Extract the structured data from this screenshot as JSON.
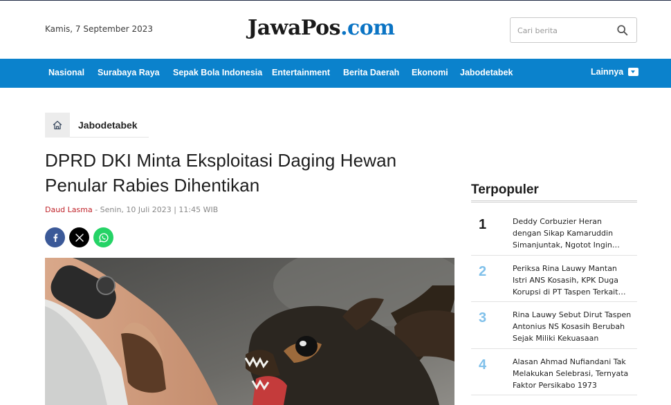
{
  "header": {
    "date": "Kamis, 7 September 2023",
    "logo_main": "JawaPos",
    "logo_suffix": ".com",
    "search_placeholder": "Cari berita",
    "search_icon": "search-icon"
  },
  "nav": {
    "items": [
      "Nasional",
      "Surabaya Raya",
      "Sepak Bola Indonesia",
      "Entertainment",
      "Berita Daerah",
      "Ekonomi",
      "Jabodetabek"
    ],
    "more_label": "Lainnya",
    "more_icon": "chevron-down-icon",
    "color": "#0b82cc"
  },
  "breadcrumb": {
    "home_icon": "home-icon",
    "label": "Jabodetabek"
  },
  "article": {
    "title": "DPRD DKI Minta Eksploitasi Daging Hewan Penular Rabies Dihentikan",
    "author": "Daud Lasma",
    "meta": " - Senin, 10 Juli 2023 | 11:45 WIB",
    "share_icons": [
      "facebook-icon",
      "x-icon",
      "whatsapp-icon"
    ]
  },
  "sidebar": {
    "title": "Terpopuler",
    "items": [
      {
        "rank": "1",
        "text": "Deddy Corbuzier Heran dengan Sikap Kamaruddin Simanjuntak, Ngotot Ingin Menjadi Pengacara"
      },
      {
        "rank": "2",
        "text": "Periksa Rina Lauwy Mantan Istri ANS Kosasih, KPK Duga Korupsi di PT Taspen Terkait Investasi"
      },
      {
        "rank": "3",
        "text": "Rina Lauwy Sebut Dirut Taspen Antonius NS Kosasih Berubah Sejak Miliki Kekuasaan"
      },
      {
        "rank": "4",
        "text": "Alasan Ahmad Nufiandani Tak Melakukan Selebrasi, Ternyata Faktor Persikabo 1973"
      }
    ]
  }
}
